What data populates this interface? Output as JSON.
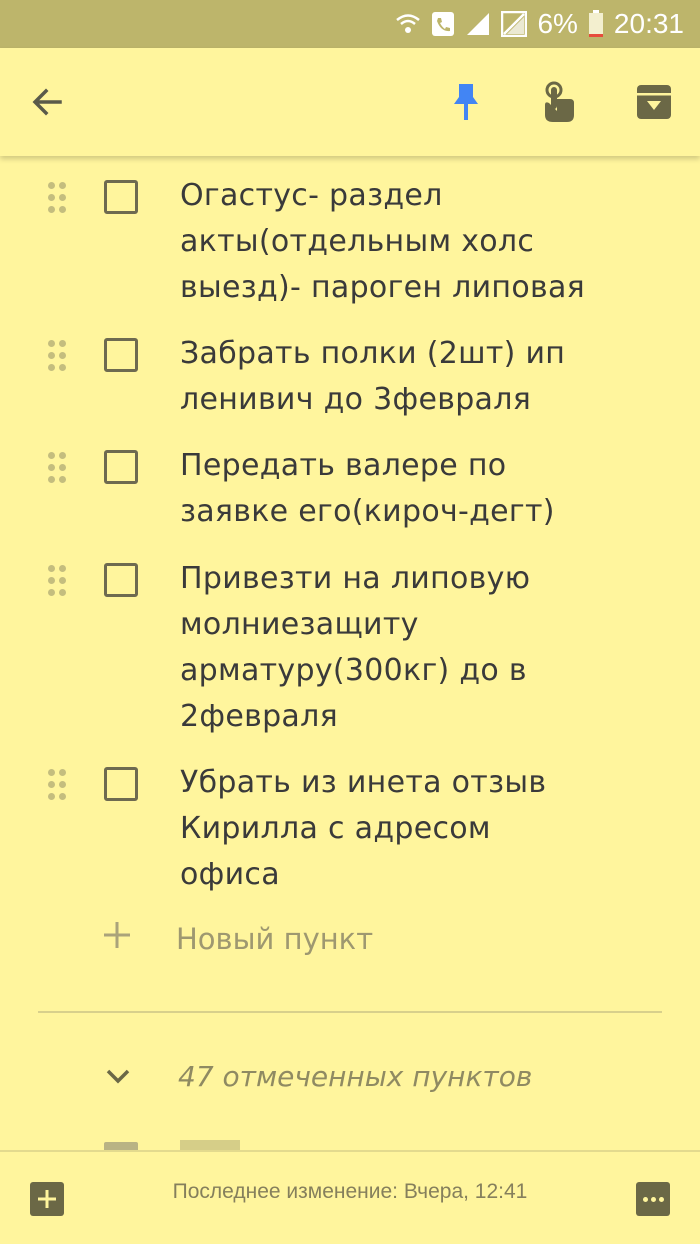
{
  "status_bar": {
    "battery_percent": "6%",
    "time": "20:31",
    "icons": [
      "wifi-icon",
      "call-icon",
      "signal-icon",
      "no-sim-icon",
      "battery-icon"
    ]
  },
  "toolbar": {
    "icons": [
      "back-arrow-icon",
      "pin-icon",
      "reminder-hand-icon",
      "archive-icon"
    ],
    "accent_color": "#4285f4"
  },
  "checklist": {
    "items": [
      {
        "text": "Огастус- раздел акты(отдельным холс выезд)- пароген липовая",
        "checked": false,
        "lines": [
          "Огастус- раздел",
          "акты(отдельным холс",
          "выезд)- пароген липовая"
        ]
      },
      {
        "text": "Забрать полки (2шт) ип ленивич до 3февраля",
        "checked": false,
        "lines": [
          "Забрать полки (2шт) ип",
          "ленивич до 3февраля"
        ]
      },
      {
        "text": "Передать валере по заявке его(кироч-дегт)",
        "checked": false,
        "lines": [
          "Передать валере по",
          "заявке его(кироч-дегт)"
        ]
      },
      {
        "text": "Привезти на липовую молниезащиту арматуру(300кг) до в 2февраля",
        "checked": false,
        "lines": [
          "Привезти на липовую",
          "молниезащиту",
          "арматуру(300кг) до в",
          "2февраля"
        ]
      },
      {
        "text": "Убрать из инета отзыв Кирилла с адресом офиса",
        "checked": false,
        "lines": [
          "Убрать из инета отзыв",
          "Кирилла с адресом",
          "офиса"
        ]
      }
    ],
    "new_item_placeholder": "Новый пункт",
    "checked_summary": "47 отмеченных пунктов"
  },
  "bottom_bar": {
    "last_edited": "Последнее изменение: Вчера, 12:41"
  },
  "colors": {
    "note_background": "#fff59d",
    "status_bar": "#bdb56b"
  }
}
